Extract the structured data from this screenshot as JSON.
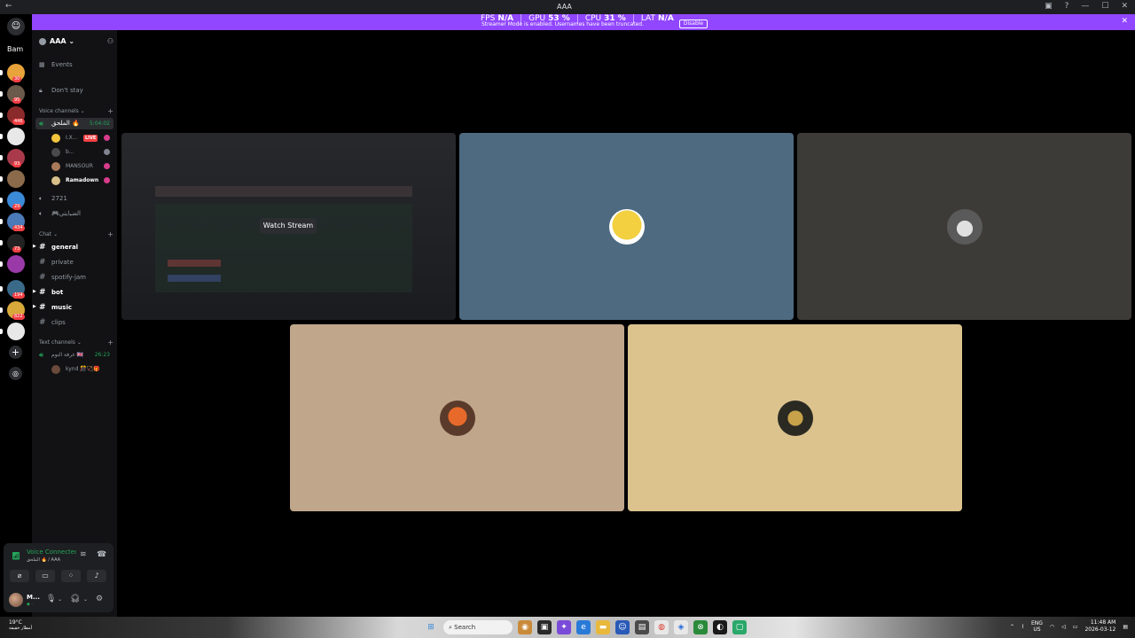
{
  "window": {
    "title": "AAA"
  },
  "banner": {
    "fps_label": "FPS",
    "fps_value": "N/A",
    "gpu_label": "GPU",
    "gpu_value": "53 %",
    "cpu_label": "CPU",
    "cpu_value": "31 %",
    "lat_label": "LAT",
    "lat_value": "N/A",
    "message": "Streamer Mode is enabled. Usernames have been truncated.",
    "disable_label": "Disable"
  },
  "rail": {
    "folder_label": "Bam",
    "servers": [
      {
        "badge": "30",
        "color": "#e8a33a"
      },
      {
        "badge": "95",
        "color": "#6a5a4a"
      },
      {
        "badge": "446",
        "color": "#8a2a2a"
      },
      {
        "badge": "",
        "color": "#e8e8e8"
      },
      {
        "badge": "93",
        "color": "#a83a4a"
      },
      {
        "badge": "",
        "color": "#8a6a4a"
      },
      {
        "badge": "29",
        "color": "#3a8ad8"
      },
      {
        "badge": "434",
        "color": "#4a7ab8"
      },
      {
        "badge": "73",
        "color": "#222222"
      },
      {
        "badge": "",
        "color": "#9a3aa8"
      },
      {
        "badge": "194",
        "color": "#3a6a8a"
      },
      {
        "badge": "822",
        "color": "#d8a83a"
      },
      {
        "badge": "",
        "color": "#e8e8e8"
      }
    ]
  },
  "sidebar": {
    "guild_name": "AAA",
    "nav": [
      {
        "icon": "calendar-icon",
        "label": "Events"
      },
      {
        "icon": "lock-icon",
        "label": "Don't stay"
      }
    ],
    "voice_category": "Voice channels",
    "active_voice": {
      "name": "الملحق 🔥",
      "timer": "5:04:02"
    },
    "voice_users": [
      {
        "name": "I.X...",
        "live": "LIVE",
        "color": "#f2c53d"
      },
      {
        "name": "b...",
        "live": "",
        "color": "#4a4a4a"
      },
      {
        "name": "MANSOUR",
        "live": "",
        "color": "#a87a5a"
      },
      {
        "name": "Ramadown",
        "live": "",
        "color": "#d8c08a"
      }
    ],
    "voice_channels": [
      {
        "label": "2721"
      },
      {
        "label": "🎮الضيايتي"
      }
    ],
    "chat_category": "Chat",
    "text_channels": [
      {
        "label": "general",
        "bold": true
      },
      {
        "label": "private",
        "bold": false
      },
      {
        "label": "spotify-jam",
        "bold": false
      },
      {
        "label": "bot",
        "bold": true
      },
      {
        "label": "music",
        "bold": true
      },
      {
        "label": "clips",
        "bold": false
      }
    ],
    "text_voice_category": "Text channels",
    "text_voice": {
      "name": "غرفة النوم 🇬🇧",
      "timer": "26:23",
      "user": "kynd 🎊🏹🎁"
    }
  },
  "voice_panel": {
    "status": "Voice Connected",
    "location": "الملحق 🔥 / AAA"
  },
  "user_panel": {
    "name": "M...",
    "status": "◆ ·"
  },
  "stage": {
    "watch_stream": "Watch Stream",
    "tiles": [
      {
        "bg": "#4e6a80",
        "avatar": "#f2d040"
      },
      {
        "bg": "#3d3b37",
        "avatar": "#8a8a8a"
      },
      {
        "bg": "#c0a68b",
        "avatar": "#c85a2a"
      },
      {
        "bg": "#dcc38e",
        "avatar": "#3a3a2a"
      }
    ]
  },
  "taskbar": {
    "weather_temp": "19°C",
    "weather_cond": "أمطار خفيفة",
    "search": "Search",
    "lang_top": "ENG",
    "lang_bottom": "US",
    "time": "11:48 AM",
    "date": "2026-03-12"
  }
}
